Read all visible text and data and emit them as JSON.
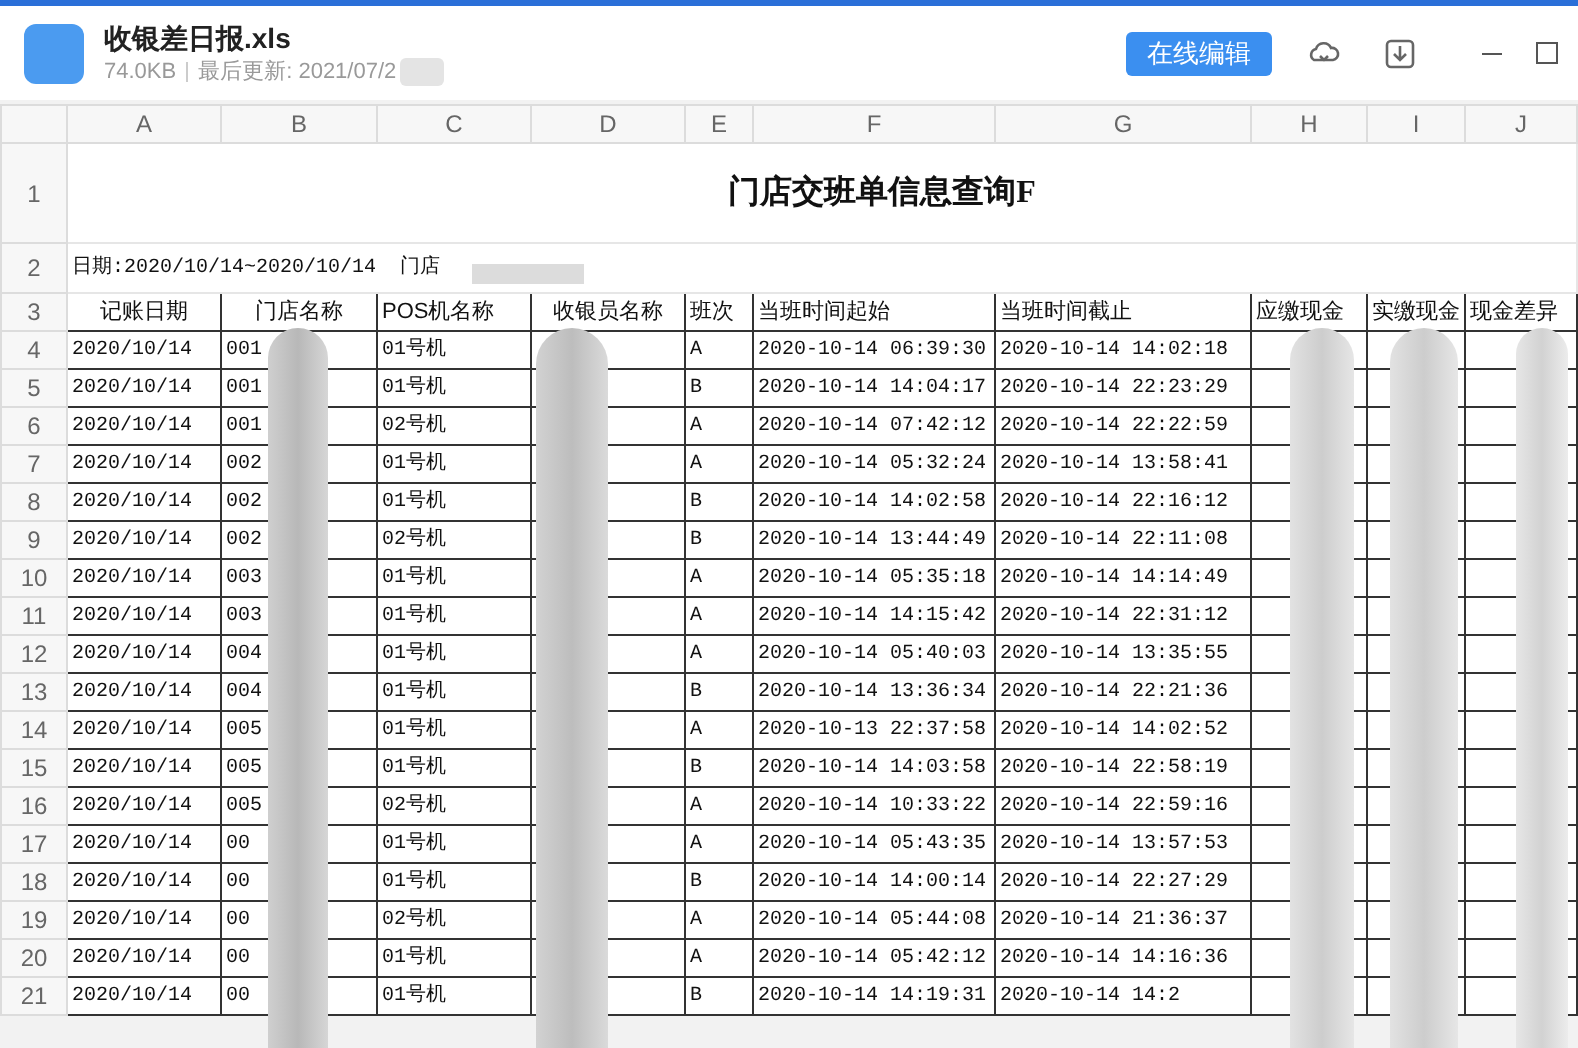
{
  "file": {
    "name": "收银差日报.xls",
    "size": "74.0KB",
    "updated": "最后更新: 2021/07/2"
  },
  "toolbar": {
    "edit_button": "在线编辑"
  },
  "sheet": {
    "columns": [
      "A",
      "B",
      "C",
      "D",
      "E",
      "F",
      "G",
      "H",
      "I",
      "J"
    ],
    "row_numbers": [
      "1",
      "2",
      "3"
    ],
    "title": "门店交班单信息查询F",
    "subtitle": "日期:2020/10/14~2020/10/14  门店",
    "headers": [
      "记账日期",
      "门店名称",
      "POS机名称",
      "收银员名称",
      "班次",
      "当班时间起始",
      "当班时间截止",
      "应缴现金",
      "实缴现金",
      "现金差异"
    ],
    "rows": [
      {
        "number": "4",
        "date": "2020/10/14",
        "store": "001",
        "pos": "01号机",
        "shift": "A",
        "start": "2020-10-14 06:39:30",
        "end": "2020-10-14 14:02:18"
      },
      {
        "number": "5",
        "date": "2020/10/14",
        "store": "001",
        "pos": "01号机",
        "shift": "B",
        "start": "2020-10-14 14:04:17",
        "end": "2020-10-14 22:23:29"
      },
      {
        "number": "6",
        "date": "2020/10/14",
        "store": "001",
        "pos": "02号机",
        "shift": "A",
        "start": "2020-10-14 07:42:12",
        "end": "2020-10-14 22:22:59"
      },
      {
        "number": "7",
        "date": "2020/10/14",
        "store": "002",
        "pos": "01号机",
        "shift": "A",
        "start": "2020-10-14 05:32:24",
        "end": "2020-10-14 13:58:41"
      },
      {
        "number": "8",
        "date": "2020/10/14",
        "store": "002",
        "pos": "01号机",
        "shift": "B",
        "start": "2020-10-14 14:02:58",
        "end": "2020-10-14 22:16:12"
      },
      {
        "number": "9",
        "date": "2020/10/14",
        "store": "002",
        "pos": "02号机",
        "shift": "B",
        "start": "2020-10-14 13:44:49",
        "end": "2020-10-14 22:11:08"
      },
      {
        "number": "10",
        "date": "2020/10/14",
        "store": "003",
        "pos": "01号机",
        "shift": "A",
        "start": "2020-10-14 05:35:18",
        "end": "2020-10-14 14:14:49"
      },
      {
        "number": "11",
        "date": "2020/10/14",
        "store": "003",
        "pos": "01号机",
        "shift": "A",
        "start": "2020-10-14 14:15:42",
        "end": "2020-10-14 22:31:12"
      },
      {
        "number": "12",
        "date": "2020/10/14",
        "store": "004",
        "pos": "01号机",
        "shift": "A",
        "start": "2020-10-14 05:40:03",
        "end": "2020-10-14 13:35:55"
      },
      {
        "number": "13",
        "date": "2020/10/14",
        "store": "004",
        "pos": "01号机",
        "shift": "B",
        "start": "2020-10-14 13:36:34",
        "end": "2020-10-14 22:21:36"
      },
      {
        "number": "14",
        "date": "2020/10/14",
        "store": "005",
        "pos": "01号机",
        "shift": "A",
        "start": "2020-10-13 22:37:58",
        "end": "2020-10-14 14:02:52"
      },
      {
        "number": "15",
        "date": "2020/10/14",
        "store": "005",
        "pos": "01号机",
        "shift": "B",
        "start": "2020-10-14 14:03:58",
        "end": "2020-10-14 22:58:19"
      },
      {
        "number": "16",
        "date": "2020/10/14",
        "store": "005",
        "pos": "02号机",
        "shift": "A",
        "start": "2020-10-14 10:33:22",
        "end": "2020-10-14 22:59:16"
      },
      {
        "number": "17",
        "date": "2020/10/14",
        "store": "00",
        "pos": "01号机",
        "shift": "A",
        "start": "2020-10-14 05:43:35",
        "end": "2020-10-14 13:57:53"
      },
      {
        "number": "18",
        "date": "2020/10/14",
        "store": "00",
        "pos": "01号机",
        "shift": "B",
        "start": "2020-10-14 14:00:14",
        "end": "2020-10-14 22:27:29"
      },
      {
        "number": "19",
        "date": "2020/10/14",
        "store": "00",
        "pos": "02号机",
        "shift": "A",
        "start": "2020-10-14 05:44:08",
        "end": "2020-10-14 21:36:37"
      },
      {
        "number": "20",
        "date": "2020/10/14",
        "store": "00",
        "pos": "01号机",
        "shift": "A",
        "start": "2020-10-14 05:42:12",
        "end": "2020-10-14 14:16:36"
      },
      {
        "number": "21",
        "date": "2020/10/14",
        "store": "00",
        "pos": "01号机",
        "shift": "B",
        "start": "2020-10-14 14:19:31",
        "end": "2020-10-14 14:2"
      }
    ]
  }
}
